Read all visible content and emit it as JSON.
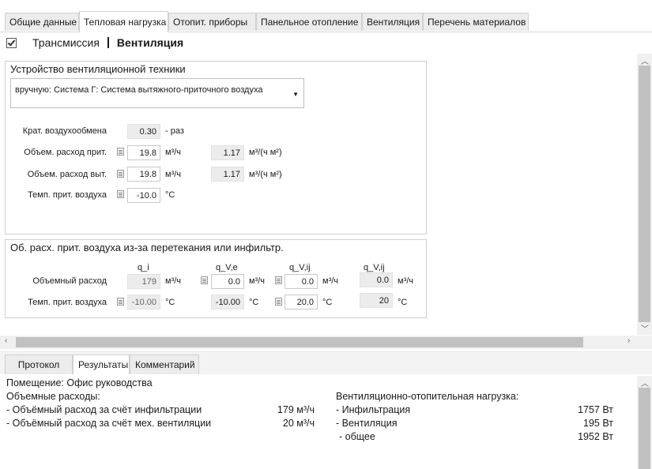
{
  "tabs": [
    "Общие данные",
    "Тепловая нагрузка",
    "Отопит. приборы",
    "Панельное отопление",
    "Вентиляция",
    "Перечень материалов"
  ],
  "active_tab": "Тепловая нагрузка",
  "subheader": {
    "checked": true,
    "item1": "Трансмиссия",
    "item2": "Вентиляция"
  },
  "group1": {
    "title": "Устройство вентиляционной техники",
    "dropdown_value": "вручную: Система Г: Система вытяжного-приточного воздуха",
    "rows": [
      {
        "label": "Крат. воздухообмена",
        "value": "0.30",
        "unit": "- раз"
      },
      {
        "label": "Объем. расход прит.",
        "value": "19.8",
        "unit": "м³/ч",
        "value2": "1.17",
        "unit2": "м³/(ч м²)"
      },
      {
        "label": "Объем. расход выт.",
        "value": "19.8",
        "unit": "м³/ч",
        "value2": "1.17",
        "unit2": "м³/(ч м²)"
      },
      {
        "label": "Темп. прит. воздуха",
        "value": "-10.0",
        "unit": "°C"
      }
    ]
  },
  "group2": {
    "title": "Об. расх. прит. воздуха из-за перетекания или инфильтр.",
    "col_heads": [
      "q_i",
      "q_V,e",
      "q_V,ij",
      "q_V,ij"
    ],
    "row1": {
      "label": "Объемный расход",
      "values": [
        "179",
        "0.0",
        "0.0",
        "0.0"
      ],
      "units": [
        "м³/ч",
        "м³/ч",
        "м³/ч",
        "м³/ч"
      ]
    },
    "row2": {
      "label": "Темп. прит. воздуха",
      "values": [
        "-10.00",
        "-10.00",
        "20.0",
        "20"
      ],
      "units": [
        "°C",
        "°C",
        "°C",
        "°C"
      ]
    }
  },
  "bottom_tabs": [
    "Протокол",
    "Результаты",
    "Комментарий"
  ],
  "active_bottom_tab": "Результаты",
  "results": {
    "room": "Помещение: Офис руководства",
    "left_title": "Объемные расходы:",
    "left_rows": [
      {
        "label": "- Объёмный расход за счёт инфильтрации",
        "value": "179 м³/ч"
      },
      {
        "label": "- Объёмный расход за счёт мех. вентиляции",
        "value": "20 м³/ч"
      }
    ],
    "right_title": "Вентиляционно-отопительная нагрузка:",
    "right_rows": [
      {
        "label": "- Инфильтрация",
        "value": "1757 Вт"
      },
      {
        "label": "- Вентиляция",
        "value": "195 Вт"
      },
      {
        "label": "- общее",
        "value": "1952 Вт"
      }
    ]
  }
}
